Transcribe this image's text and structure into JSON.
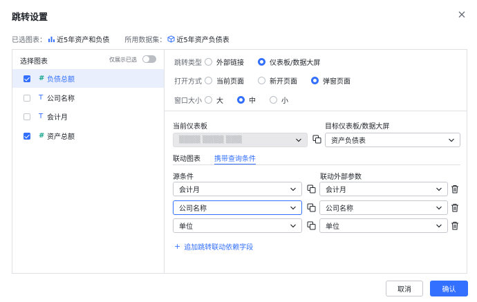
{
  "dialog": {
    "title": "跳转设置"
  },
  "selection": {
    "chart_label": "已选图表：",
    "chart_value": "近5年资产和负债",
    "dataset_label": "所用数据集：",
    "dataset_value": "近5年资产负债表"
  },
  "left": {
    "title": "选择图表",
    "only_selected": "仅展示已选",
    "fields": [
      {
        "type": "#",
        "name": "负债总额",
        "checked": true
      },
      {
        "type": "T",
        "name": "公司名称",
        "checked": false
      },
      {
        "type": "T",
        "name": "会计月",
        "checked": false
      },
      {
        "type": "#",
        "name": "资产总额",
        "checked": true
      }
    ]
  },
  "jump_type": {
    "label": "跳转类型",
    "options": [
      "外部链接",
      "仪表板/数据大屏"
    ],
    "selected": "仪表板/数据大屏"
  },
  "open_mode": {
    "label": "打开方式",
    "options": [
      "当前页面",
      "新开页面",
      "弹窗页面"
    ],
    "selected": "弹窗页面"
  },
  "window_size": {
    "label": "窗口大小",
    "options": [
      "大",
      "中",
      "小"
    ],
    "selected": "中"
  },
  "current_dashboard": {
    "label": "当前仪表板",
    "value": "▒▒▒▒ ▒▒▒▒ ▒▒▒"
  },
  "target_dashboard": {
    "label": "目标仪表板/数据大屏",
    "value": "资产负债表"
  },
  "tabs": [
    "联动图表",
    "携带查询条件"
  ],
  "active_tab": "携带查询条件",
  "conditions": {
    "source_label": "源条件",
    "target_label": "联动外部参数",
    "rows": [
      {
        "source": "会计月",
        "target": "会计月"
      },
      {
        "source": "公司名称",
        "target": "公司名称"
      },
      {
        "source": "单位",
        "target": "单位"
      }
    ]
  },
  "add_field": "追加跳转联动依赖字段",
  "buttons": {
    "cancel": "取消",
    "ok": "确认"
  },
  "colors": {
    "primary": "#3370ff",
    "number_type": "#17a58d",
    "border": "#dee0e3"
  }
}
